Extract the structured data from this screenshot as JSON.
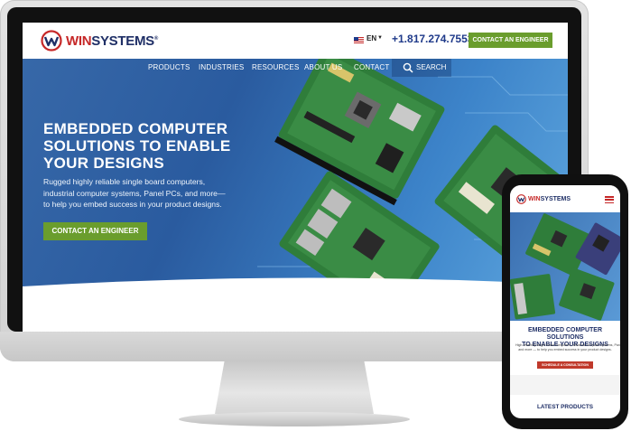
{
  "brand": {
    "part1": "WIN",
    "part2": "SYSTEMS",
    "mark": "®",
    "color_red": "#c62828",
    "color_navy": "#1f2f66"
  },
  "header": {
    "language": "EN",
    "phone": "+1.817.274.7553",
    "cta": "CONTACT AN ENGINEER",
    "cta_color": "#6a9d2d"
  },
  "nav": {
    "items": [
      "PRODUCTS",
      "INDUSTRIES",
      "RESOURCES",
      "ABOUT US",
      "CONTACT"
    ],
    "search_label": "SEARCH"
  },
  "hero": {
    "title_lines": [
      "EMBEDDED COMPUTER",
      "SOLUTIONS TO ENABLE",
      "YOUR DESIGNS"
    ],
    "subtitle_lines": [
      "Rugged highly reliable single board computers,",
      "industrial computer systems, Panel PCs, and more—",
      "to help you embed success in your product designs."
    ],
    "cta": "CONTACT AN ENGINEER"
  },
  "mobile": {
    "title_lines": [
      "EMBEDDED COMPUTER SOLUTIONS",
      "TO ENABLE YOUR DESIGNS"
    ],
    "subtitle_lines": [
      "High-reliability single board computers, industrial computer systems, Panel PCs,",
      "and more — to help you embed success in your product designs."
    ],
    "cta": "SCHEDULE A CONSULTATION",
    "cta_color": "#c0392b",
    "latest": "LATEST PRODUCTS"
  },
  "icons": [
    "logo-mark",
    "us-flag-icon",
    "caret-down-icon",
    "search-icon",
    "hamburger-menu-icon",
    "apple-logo-icon"
  ]
}
